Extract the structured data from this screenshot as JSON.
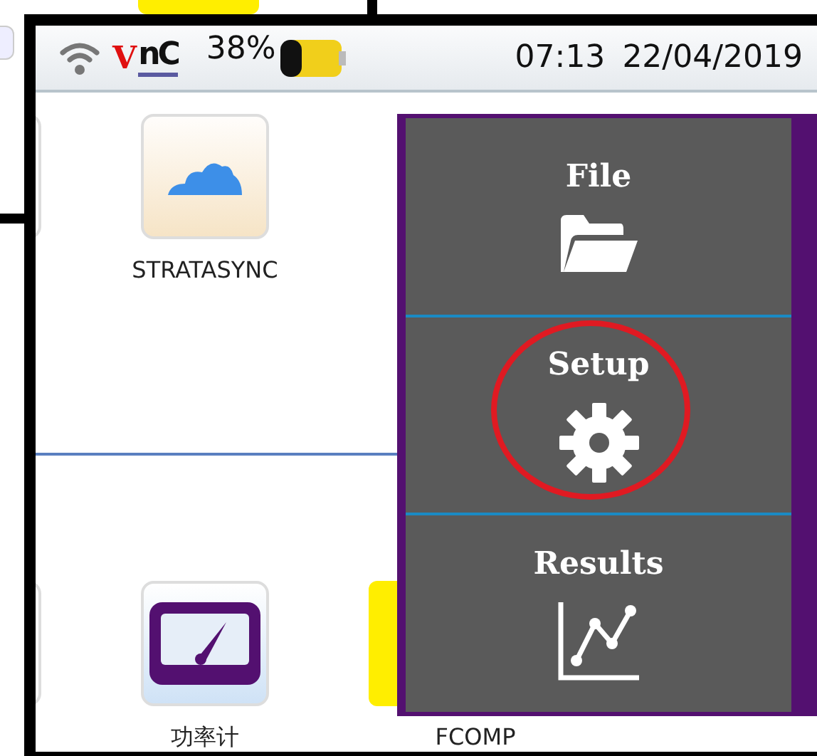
{
  "status_bar": {
    "logo": {
      "text": "nC",
      "mark": "V"
    },
    "battery": "38%",
    "time": "07:13",
    "date": "22/04/2019"
  },
  "app_rows": [
    {
      "apps": [
        {
          "kind": "cloud",
          "label": "STRATASYNC"
        }
      ]
    },
    {
      "apps": [
        {
          "kind": "meter",
          "label": "功率计"
        },
        {
          "kind": "fcomp",
          "label": "FCOMP"
        }
      ]
    }
  ],
  "menu": [
    {
      "label": "File",
      "kind": "folder",
      "highlighted": false
    },
    {
      "label": "Setup",
      "kind": "gear",
      "highlighted": true
    },
    {
      "label": "Results",
      "kind": "chart",
      "highlighted": false
    }
  ]
}
